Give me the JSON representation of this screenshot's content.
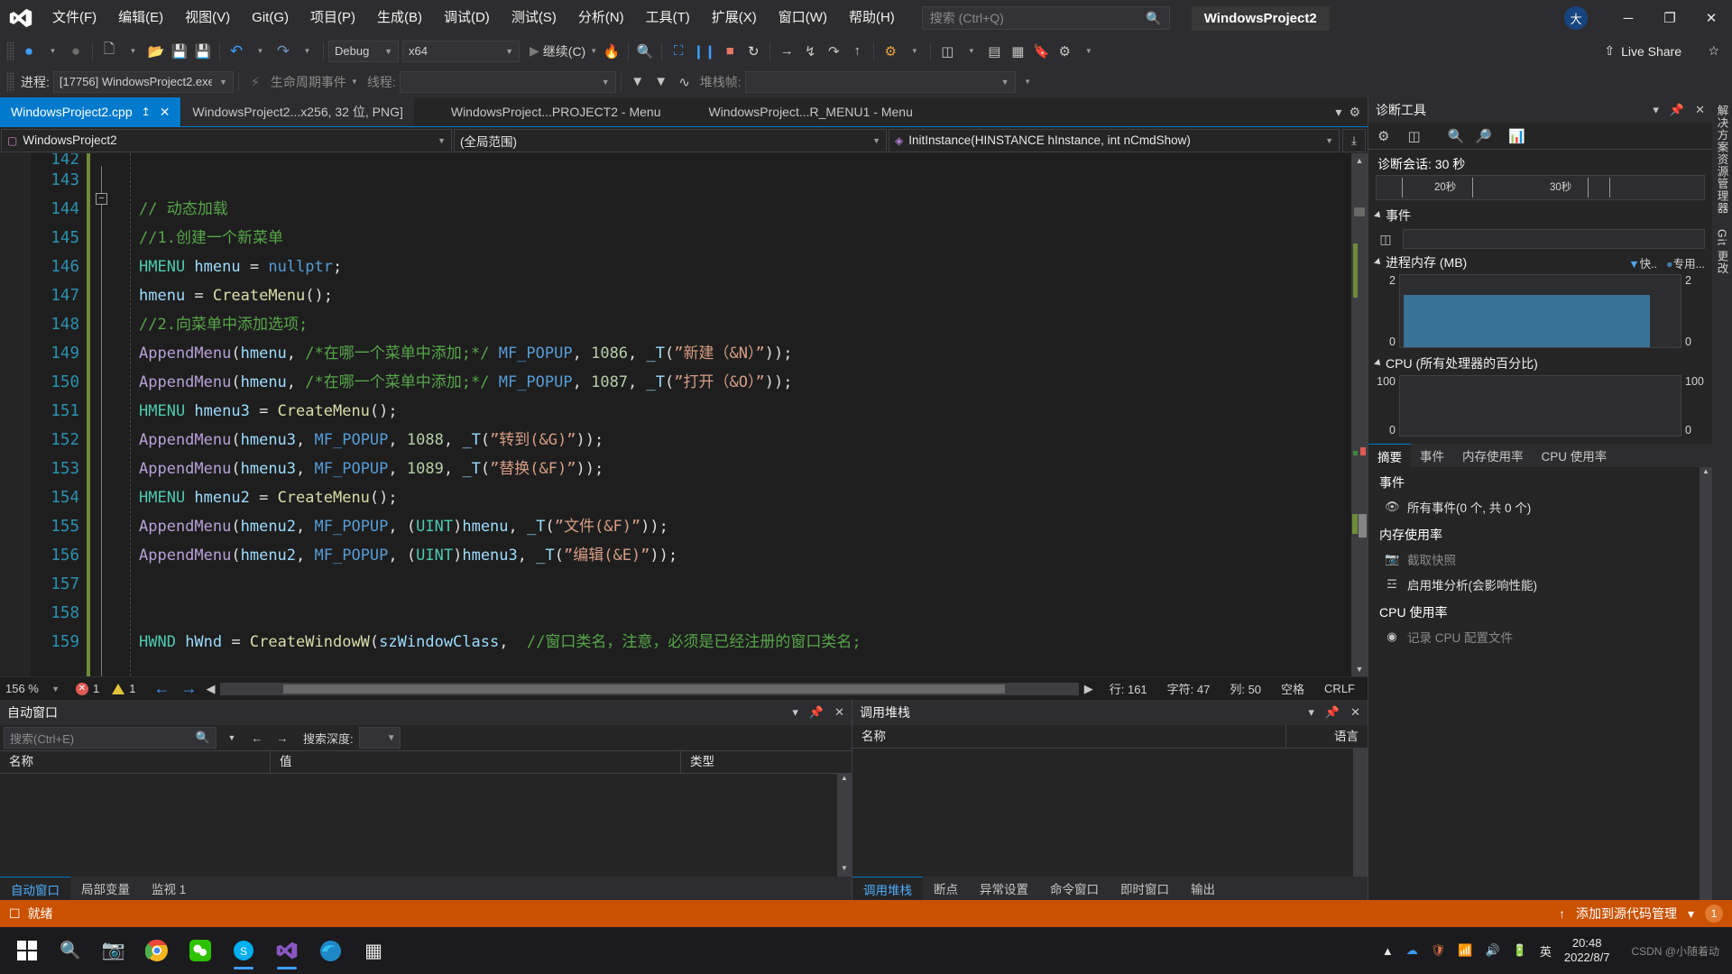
{
  "titlebar": {
    "logo_icon": "visual-studio-logo",
    "menus": [
      "文件(F)",
      "编辑(E)",
      "视图(V)",
      "Git(G)",
      "项目(P)",
      "生成(B)",
      "调试(D)",
      "测试(S)",
      "分析(N)",
      "工具(T)",
      "扩展(X)",
      "窗口(W)",
      "帮助(H)"
    ],
    "search_placeholder": "搜索 (Ctrl+Q)",
    "search_icon": "search-icon",
    "project_chip": "WindowsProject2",
    "account_initial": "大",
    "minimize": "─",
    "restore": "❐",
    "close": "✕"
  },
  "toolbar": {
    "nav_back": "◀",
    "nav_forward": "▶",
    "new_item": "new-item-icon",
    "open_file": "open-file-icon",
    "save": "save-icon",
    "save_all": "save-all-icon",
    "undo": "undo-icon",
    "redo": "redo-icon",
    "config": "Debug",
    "platform": "x64",
    "continue_label": "继续(C)",
    "hot_reload": "hot-reload-icon",
    "attach": "attach-icon",
    "step_icons": [
      "break-all",
      "stop",
      "restart",
      "show-next-statement",
      "step-into",
      "step-over",
      "step-out"
    ],
    "live_share": "Live Share"
  },
  "debugbar": {
    "process_label": "进程:",
    "process_value": "[17756] WindowsProject2.exe",
    "lifecycle_label": "生命周期事件",
    "thread_label": "线程:",
    "thread_value": "",
    "stackframe_label": "堆栈帧:",
    "stackframe_value": ""
  },
  "tabs": [
    {
      "label": "WindowsProject2.cpp",
      "active": true,
      "pin": "↥",
      "close": "✕"
    },
    {
      "label": "WindowsProject2...x256, 32 位, PNG]",
      "active": false
    },
    {
      "label": "WindowsProject...PROJECT2 - Menu",
      "active": false
    },
    {
      "label": "WindowsProject...R_MENU1 - Menu",
      "active": false
    }
  ],
  "tabstrip": {
    "overflow_icon": "chevron-down-icon",
    "settings_icon": "gear-icon"
  },
  "navbar": {
    "project": "WindowsProject2",
    "project_icon": "cpp-file-icon",
    "scope": "(全局范围)",
    "member": "InitInstance(HINSTANCE hInstance, int nCmdShow)",
    "member_icon": "method-icon",
    "split_icon": "split-view-icon"
  },
  "editor": {
    "first_visible_partial": "142",
    "lines": [
      {
        "num": "143",
        "segments": []
      },
      {
        "num": "144",
        "fold": true,
        "segments": [
          {
            "t": "// 动态加载",
            "c": "c-com"
          }
        ]
      },
      {
        "num": "145",
        "segments": [
          {
            "t": "//1.创建一个新菜单",
            "c": "c-com"
          }
        ]
      },
      {
        "num": "146",
        "segments": [
          {
            "t": "HMENU",
            "c": "c-typ"
          },
          {
            "t": " hmenu ",
            "c": "c-id"
          },
          {
            "t": "= ",
            "c": "c-pun"
          },
          {
            "t": "nullptr",
            "c": "c-key"
          },
          {
            "t": ";",
            "c": "c-pun"
          }
        ]
      },
      {
        "num": "147",
        "segments": [
          {
            "t": "hmenu ",
            "c": "c-id"
          },
          {
            "t": "= ",
            "c": "c-pun"
          },
          {
            "t": "CreateMenu",
            "c": "c-fn"
          },
          {
            "t": "();",
            "c": "c-pun"
          }
        ]
      },
      {
        "num": "148",
        "segments": [
          {
            "t": "//2.向菜单中添加选项;",
            "c": "c-com"
          }
        ]
      },
      {
        "num": "149",
        "segments": [
          {
            "t": "AppendMenu",
            "c": "c-mac"
          },
          {
            "t": "(",
            "c": "c-pun"
          },
          {
            "t": "hmenu",
            "c": "c-id"
          },
          {
            "t": ", ",
            "c": "c-pun"
          },
          {
            "t": "/*在哪一个菜单中添加;*/",
            "c": "c-com"
          },
          {
            "t": " ",
            "c": "c-pun"
          },
          {
            "t": "MF_POPUP",
            "c": "c-key"
          },
          {
            "t": ", ",
            "c": "c-pun"
          },
          {
            "t": "1086",
            "c": "c-num"
          },
          {
            "t": ", ",
            "c": "c-pun"
          },
          {
            "t": "_T",
            "c": "c-id"
          },
          {
            "t": "(",
            "c": "c-pun"
          },
          {
            "t": "”新建（&N）”",
            "c": "c-str"
          },
          {
            "t": "));",
            "c": "c-pun"
          }
        ]
      },
      {
        "num": "150",
        "segments": [
          {
            "t": "AppendMenu",
            "c": "c-mac"
          },
          {
            "t": "(",
            "c": "c-pun"
          },
          {
            "t": "hmenu",
            "c": "c-id"
          },
          {
            "t": ", ",
            "c": "c-pun"
          },
          {
            "t": "/*在哪一个菜单中添加;*/",
            "c": "c-com"
          },
          {
            "t": " ",
            "c": "c-pun"
          },
          {
            "t": "MF_POPUP",
            "c": "c-key"
          },
          {
            "t": ", ",
            "c": "c-pun"
          },
          {
            "t": "1087",
            "c": "c-num"
          },
          {
            "t": ", ",
            "c": "c-pun"
          },
          {
            "t": "_T",
            "c": "c-id"
          },
          {
            "t": "(",
            "c": "c-pun"
          },
          {
            "t": "”打开（&O）”",
            "c": "c-str"
          },
          {
            "t": "));",
            "c": "c-pun"
          }
        ]
      },
      {
        "num": "151",
        "segments": [
          {
            "t": "HMENU",
            "c": "c-typ"
          },
          {
            "t": " hmenu3 ",
            "c": "c-id"
          },
          {
            "t": "= ",
            "c": "c-pun"
          },
          {
            "t": "CreateMenu",
            "c": "c-fn"
          },
          {
            "t": "();",
            "c": "c-pun"
          }
        ]
      },
      {
        "num": "152",
        "segments": [
          {
            "t": "AppendMenu",
            "c": "c-mac"
          },
          {
            "t": "(",
            "c": "c-pun"
          },
          {
            "t": "hmenu3",
            "c": "c-id"
          },
          {
            "t": ", ",
            "c": "c-pun"
          },
          {
            "t": "MF_POPUP",
            "c": "c-key"
          },
          {
            "t": ", ",
            "c": "c-pun"
          },
          {
            "t": "1088",
            "c": "c-num"
          },
          {
            "t": ", ",
            "c": "c-pun"
          },
          {
            "t": "_T",
            "c": "c-id"
          },
          {
            "t": "(",
            "c": "c-pun"
          },
          {
            "t": "”转到(&G)”",
            "c": "c-str"
          },
          {
            "t": "));",
            "c": "c-pun"
          }
        ]
      },
      {
        "num": "153",
        "segments": [
          {
            "t": "AppendMenu",
            "c": "c-mac"
          },
          {
            "t": "(",
            "c": "c-pun"
          },
          {
            "t": "hmenu3",
            "c": "c-id"
          },
          {
            "t": ", ",
            "c": "c-pun"
          },
          {
            "t": "MF_POPUP",
            "c": "c-key"
          },
          {
            "t": ", ",
            "c": "c-pun"
          },
          {
            "t": "1089",
            "c": "c-num"
          },
          {
            "t": ", ",
            "c": "c-pun"
          },
          {
            "t": "_T",
            "c": "c-id"
          },
          {
            "t": "(",
            "c": "c-pun"
          },
          {
            "t": "”替换(&F)”",
            "c": "c-str"
          },
          {
            "t": "));",
            "c": "c-pun"
          }
        ]
      },
      {
        "num": "154",
        "segments": [
          {
            "t": "HMENU",
            "c": "c-typ"
          },
          {
            "t": " hmenu2 ",
            "c": "c-id"
          },
          {
            "t": "= ",
            "c": "c-pun"
          },
          {
            "t": "CreateMenu",
            "c": "c-fn"
          },
          {
            "t": "();",
            "c": "c-pun"
          }
        ]
      },
      {
        "num": "155",
        "segments": [
          {
            "t": "AppendMenu",
            "c": "c-mac"
          },
          {
            "t": "(",
            "c": "c-pun"
          },
          {
            "t": "hmenu2",
            "c": "c-id"
          },
          {
            "t": ", ",
            "c": "c-pun"
          },
          {
            "t": "MF_POPUP",
            "c": "c-key"
          },
          {
            "t": ", ",
            "c": "c-pun"
          },
          {
            "t": "(",
            "c": "c-pun"
          },
          {
            "t": "UINT",
            "c": "c-typ"
          },
          {
            "t": ")",
            "c": "c-pun"
          },
          {
            "t": "hmenu",
            "c": "c-id"
          },
          {
            "t": ", ",
            "c": "c-pun"
          },
          {
            "t": "_T",
            "c": "c-id"
          },
          {
            "t": "(",
            "c": "c-pun"
          },
          {
            "t": "”文件(&F)”",
            "c": "c-str"
          },
          {
            "t": "));",
            "c": "c-pun"
          }
        ]
      },
      {
        "num": "156",
        "segments": [
          {
            "t": "AppendMenu",
            "c": "c-mac"
          },
          {
            "t": "(",
            "c": "c-pun"
          },
          {
            "t": "hmenu2",
            "c": "c-id"
          },
          {
            "t": ", ",
            "c": "c-pun"
          },
          {
            "t": "MF_POPUP",
            "c": "c-key"
          },
          {
            "t": ", ",
            "c": "c-pun"
          },
          {
            "t": "(",
            "c": "c-pun"
          },
          {
            "t": "UINT",
            "c": "c-typ"
          },
          {
            "t": ")",
            "c": "c-pun"
          },
          {
            "t": "hmenu3",
            "c": "c-id"
          },
          {
            "t": ", ",
            "c": "c-pun"
          },
          {
            "t": "_T",
            "c": "c-id"
          },
          {
            "t": "(",
            "c": "c-pun"
          },
          {
            "t": "”编辑(&E)”",
            "c": "c-str"
          },
          {
            "t": "));",
            "c": "c-pun"
          }
        ]
      },
      {
        "num": "157",
        "segments": []
      },
      {
        "num": "158",
        "segments": []
      },
      {
        "num": "159",
        "segments": [
          {
            "t": "HWND",
            "c": "c-typ"
          },
          {
            "t": " hWnd ",
            "c": "c-id"
          },
          {
            "t": "= ",
            "c": "c-pun"
          },
          {
            "t": "CreateWindowW",
            "c": "c-fn"
          },
          {
            "t": "(",
            "c": "c-pun"
          },
          {
            "t": "szWindowClass",
            "c": "c-id"
          },
          {
            "t": ",  ",
            "c": "c-pun"
          },
          {
            "t": "//窗口类名，注意，必须是已经注册的窗口类名;",
            "c": "c-com"
          }
        ]
      }
    ]
  },
  "editor_status": {
    "zoom": "156 %",
    "error_count": "1",
    "warning_count": "1",
    "back_icon": "arrow-left-icon",
    "forward_icon": "arrow-right-icon",
    "line_label": "行: 161",
    "char_label": "字符: 47",
    "col_label": "列: 50",
    "space_label": "空格",
    "eol_label": "CRLF"
  },
  "autos_panel": {
    "title": "自动窗口",
    "search_placeholder": "搜索(Ctrl+E)",
    "search_icon": "search-icon",
    "depth_label": "搜索深度:",
    "depth_value": "",
    "columns": [
      "名称",
      "值",
      "类型"
    ],
    "rows": [],
    "tabs": [
      "自动窗口",
      "局部变量",
      "监视 1"
    ],
    "selected_tab": "自动窗口",
    "pin_icon": "pin-icon",
    "close_icon": "close-icon",
    "menu_icon": "chevron-down-icon"
  },
  "callstack_panel": {
    "title": "调用堆栈",
    "columns": [
      "名称",
      "语言"
    ],
    "rows": [],
    "tabs": [
      "调用堆栈",
      "断点",
      "异常设置",
      "命令窗口",
      "即时窗口",
      "输出"
    ],
    "selected_tab": "调用堆栈",
    "pin_icon": "pin-icon",
    "close_icon": "close-icon",
    "menu_icon": "chevron-down-icon"
  },
  "diagnostics": {
    "title": "诊断工具",
    "menu_icon": "chevron-down-icon",
    "pin_icon": "pin-icon",
    "close_icon": "close-icon",
    "tool_icons": [
      "gear-icon",
      "select-range-icon",
      "zoom-in-icon",
      "zoom-out-icon",
      "reset-zoom-icon"
    ],
    "session_label": "诊断会话: 30 秒",
    "timeline_ticks": [
      "20秒",
      "30秒"
    ],
    "events_label": "事件",
    "events_track_icon": "events-track-icon",
    "memory_label": "进程内存 (MB)",
    "memory_legend": [
      {
        "marker": "▼",
        "label": "快..",
        "color": "#4fa3e3"
      },
      {
        "marker": "●",
        "label": "专用...",
        "color": "#3d7fa8"
      }
    ],
    "memory_axis": {
      "max": "2",
      "min": "0"
    },
    "cpu_label": "CPU (所有处理器的百分比)",
    "cpu_axis": {
      "max": "100",
      "min": "0"
    },
    "tabs": [
      "摘要",
      "事件",
      "内存使用率",
      "CPU 使用率"
    ],
    "selected_tab": "摘要",
    "sections": [
      {
        "title": "事件",
        "items": [
          {
            "icon": "eye-icon",
            "label": "所有事件(0 个, 共 0 个)",
            "dim": false
          }
        ]
      },
      {
        "title": "内存使用率",
        "items": [
          {
            "icon": "camera-icon",
            "label": "截取快照",
            "dim": true
          },
          {
            "icon": "heap-icon",
            "label": "启用堆分析(会影响性能)",
            "dim": false
          }
        ]
      },
      {
        "title": "CPU 使用率",
        "items": [
          {
            "icon": "record-icon",
            "label": "记录 CPU 配置文件",
            "dim": true
          }
        ]
      }
    ]
  },
  "right_rail": [
    "解决方案资源管理器",
    "Git 更改"
  ],
  "statusbar": {
    "icon": "ready-icon",
    "text": "就绪",
    "source_control": "添加到源代码管理",
    "up_icon": "↑",
    "chevron_icon": "▾",
    "notification_count": "1",
    "bell_icon": "bell-icon"
  },
  "taskbar": {
    "start_icon": "windows-start-icon",
    "search_icon": "search-icon",
    "items": [
      "camera-app",
      "chrome",
      "wechat",
      "skype",
      "visual-studio",
      "edge",
      "store"
    ],
    "active_item": "visual-studio",
    "tray_icons": [
      "chevron-up-icon",
      "onedrive-icon",
      "security-icon",
      "network-icon",
      "volume-icon",
      "battery-icon"
    ],
    "ime": "英",
    "time": "20:48",
    "date": "2022/8/7",
    "watermark": "CSDN @小随着动"
  }
}
